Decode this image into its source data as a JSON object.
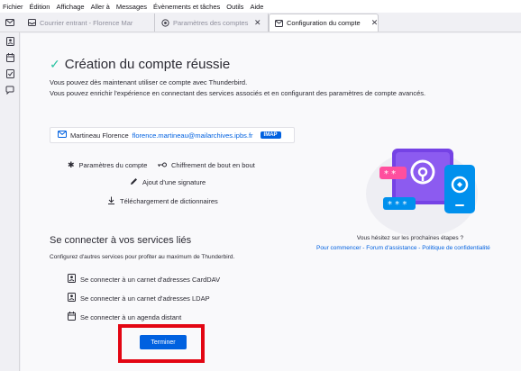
{
  "menubar": {
    "items": [
      {
        "label": "Fichier"
      },
      {
        "label": "Édition"
      },
      {
        "label": "Affichage"
      },
      {
        "label": "Aller à"
      },
      {
        "label": "Messages"
      },
      {
        "label": "Évènements et tâches"
      },
      {
        "label": "Outils"
      },
      {
        "label": "Aide"
      }
    ]
  },
  "tabs": [
    {
      "label": "Courrier entrant - Florence Mar",
      "icon": "inbox-icon",
      "active": false
    },
    {
      "label": "Paramètres des comptes Co",
      "icon": "gear-icon",
      "active": false
    },
    {
      "label": "Configuration du compte",
      "icon": "mail-icon",
      "active": true
    }
  ],
  "spaces": [
    {
      "icon": "mail-icon"
    },
    {
      "icon": "address-book-icon"
    },
    {
      "icon": "calendar-icon"
    },
    {
      "icon": "tasks-icon"
    },
    {
      "icon": "chat-icon"
    }
  ],
  "main": {
    "title": "Création du compte réussie",
    "desc1": "Vous pouvez dès maintenant utiliser ce compte avec Thunderbird.",
    "desc2": "Vous pouvez enrichir l'expérience en connectant des services associés et en configurant des paramètres de compte avancés.",
    "account": {
      "name": "Martineau Florence",
      "email": "florence.martineau@mailarchives.ipbs.fr",
      "type": "IMAP"
    },
    "links": {
      "account_settings": "Paramètres du compte",
      "e2ee": "Chiffrement de bout en bout",
      "signature": "Ajout d'une signature",
      "dictionaries": "Téléchargement de dictionnaires"
    },
    "services": {
      "title": "Se connecter à vos services liés",
      "desc": "Configurez d'autres services pour profiter au maximum de Thunderbird.",
      "carddav": "Se connecter à un carnet d'adresses CardDAV",
      "ldap": "Se connecter à un carnet d'adresses LDAP",
      "calendar": "Se connecter à un agenda distant"
    },
    "finish_label": "Terminer",
    "help": {
      "question": "Vous hésitez sur les prochaines étapes ?",
      "start": "Pour commencer",
      "forum": "Forum d'assistance",
      "privacy": "Politique de confidentialité",
      "sep": " - "
    },
    "illustration": {
      "password_mask_1": "* *",
      "password_mask_2": "* * *"
    }
  },
  "colors": {
    "accent": "#0061e0",
    "success": "#2ac3a2",
    "highlight": "#e30613",
    "illustration_purple": "#7542e5",
    "illustration_pink": "#ff4f9e",
    "illustration_blue": "#0090ed"
  }
}
